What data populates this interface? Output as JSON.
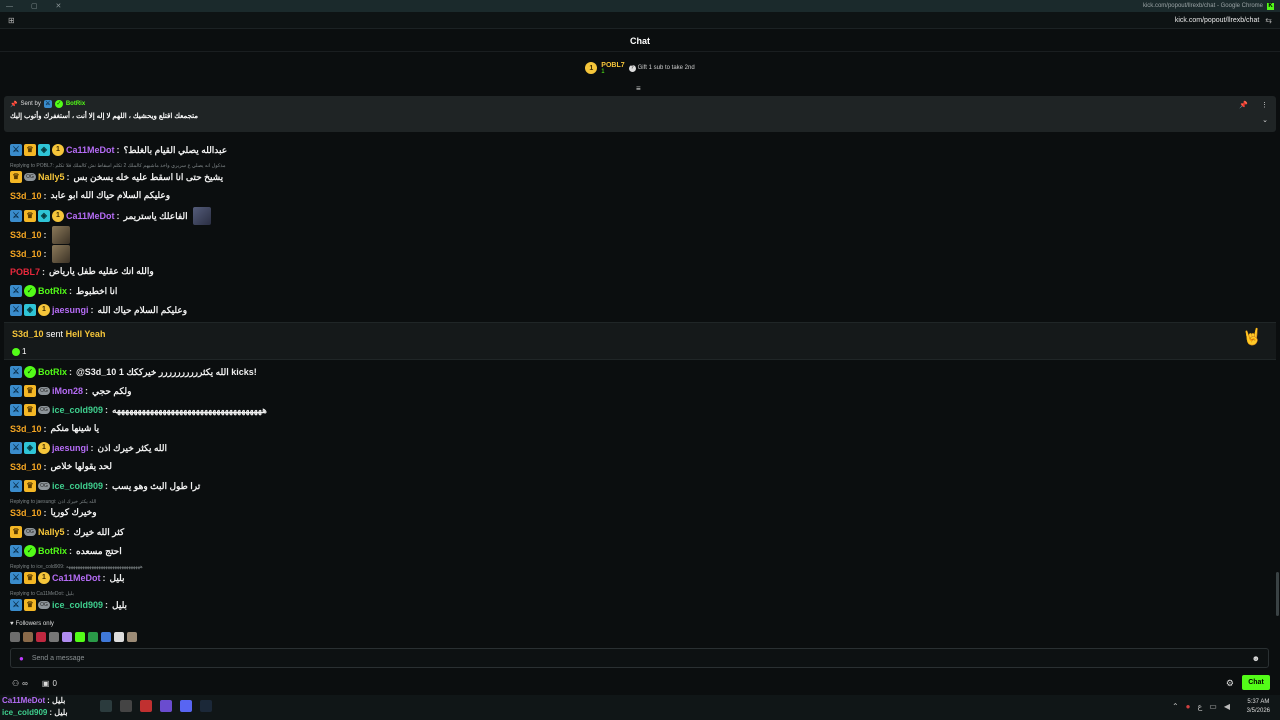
{
  "window": {
    "title": "kick.com/popout/llrexb/chat - Google Chrome",
    "url": "kick.com/popout/llrexb/chat"
  },
  "header": {
    "title": "Chat"
  },
  "gift_leader": {
    "name": "POBL7",
    "rank": "1",
    "count": "1",
    "text": "Gift 1 sub to take 2nd"
  },
  "pinned": {
    "sent_by_label": "Sent by",
    "author": "BotRix",
    "message": "متجمعك اقتلع ويحشيك ، اللهم لا إله إلا أنت ، أستغفرك وأتوب إليك"
  },
  "messages": [
    {
      "user": "Ca11MeDot",
      "color": "#b56cf5",
      "text": "عبدالله يصلي القيام بالغلط؟"
    },
    {
      "user": "Nally5",
      "color": "#f5c53a",
      "text": "يشيخ حتى انا اسقط عليه خله يسخن بس",
      "reply": "Replying to POBL7: مذكول انه يصلي ع سريري واخذ ماشيهم كالملك 2 تكلم اسقاط نش كالملك فلا تكلم"
    },
    {
      "user": "S3d_10",
      "color": "#f5a623",
      "text": "وعليكم السلام حياك الله ابو عابد"
    },
    {
      "user": "Ca11MeDot",
      "color": "#b56cf5",
      "text": "الفاعلك ياستريمر"
    },
    {
      "user": "S3d_10",
      "color": "#f5a623",
      "text": ""
    },
    {
      "user": "S3d_10",
      "color": "#f5a623",
      "text": ""
    },
    {
      "user": "POBL7",
      "color": "#e8283c",
      "text": "والله انك عقليه طفل يارياض"
    },
    {
      "user": "BotRix",
      "color": "#53fc18",
      "text": "انا اخطبوط"
    },
    {
      "user": "jaesungi",
      "color": "#b56cf5",
      "text": "وعليكم السلام حياك الله"
    },
    {
      "user": "BotRix",
      "color": "#53fc18",
      "text": "@S3d_10 الله يكثرررررررررر خيرككك 1 kicks!"
    },
    {
      "user": "iMon28",
      "color": "#b56cf5",
      "text": "ولكم حجي"
    },
    {
      "user": "ice_cold909",
      "color": "#3fcf8e",
      "text": "ههههههههههههههههههههههههههههههههههههه"
    },
    {
      "user": "S3d_10",
      "color": "#f5a623",
      "text": "يا شينها منكم"
    },
    {
      "user": "jaesungi",
      "color": "#b56cf5",
      "text": "الله يكثر خيرك اذن"
    },
    {
      "user": "S3d_10",
      "color": "#f5a623",
      "text": "لحد يقولها خلاص"
    },
    {
      "user": "ice_cold909",
      "color": "#3fcf8e",
      "text": "ترا طول البث وهو يسب"
    },
    {
      "user": "S3d_10",
      "color": "#f5a623",
      "text": "وخيرك كوريا",
      "reply": "Replying to jaesungi: الله يكثر خيرك اذن"
    },
    {
      "user": "Nally5",
      "color": "#f5c53a",
      "text": "كثر الله خيرك"
    },
    {
      "user": "BotRix",
      "color": "#53fc18",
      "text": "احتج مسعده"
    },
    {
      "user": "Ca11MeDot",
      "color": "#b56cf5",
      "text": "بليل",
      "reply": "Replying to ice_cold909: ههههههههههههههههههههههههههههههههه"
    },
    {
      "user": "ice_cold909",
      "color": "#3fcf8e",
      "text": "بليل",
      "reply": "Replying to Ca11MeDot: بليل"
    }
  ],
  "kicks_gift": {
    "user": "S3d_10",
    "sent": "sent",
    "gift": "Hell Yeah",
    "amount": "1"
  },
  "followers_only": "Followers only",
  "input": {
    "placeholder": "Send a message"
  },
  "bottom": {
    "viewers": "∞",
    "count": "0",
    "chat_button": "Chat"
  },
  "taskbar": {
    "overlay_line1": {
      "user": "Ca11MeDot",
      "text": ": بليل"
    },
    "overlay_line2": {
      "user": "ice_cold909",
      "text": ": بليل"
    },
    "time": "5:37 AM",
    "date": "3/5/2026"
  },
  "colors": {
    "kick_green": "#53fc18",
    "bg": "#0b0e0f"
  }
}
